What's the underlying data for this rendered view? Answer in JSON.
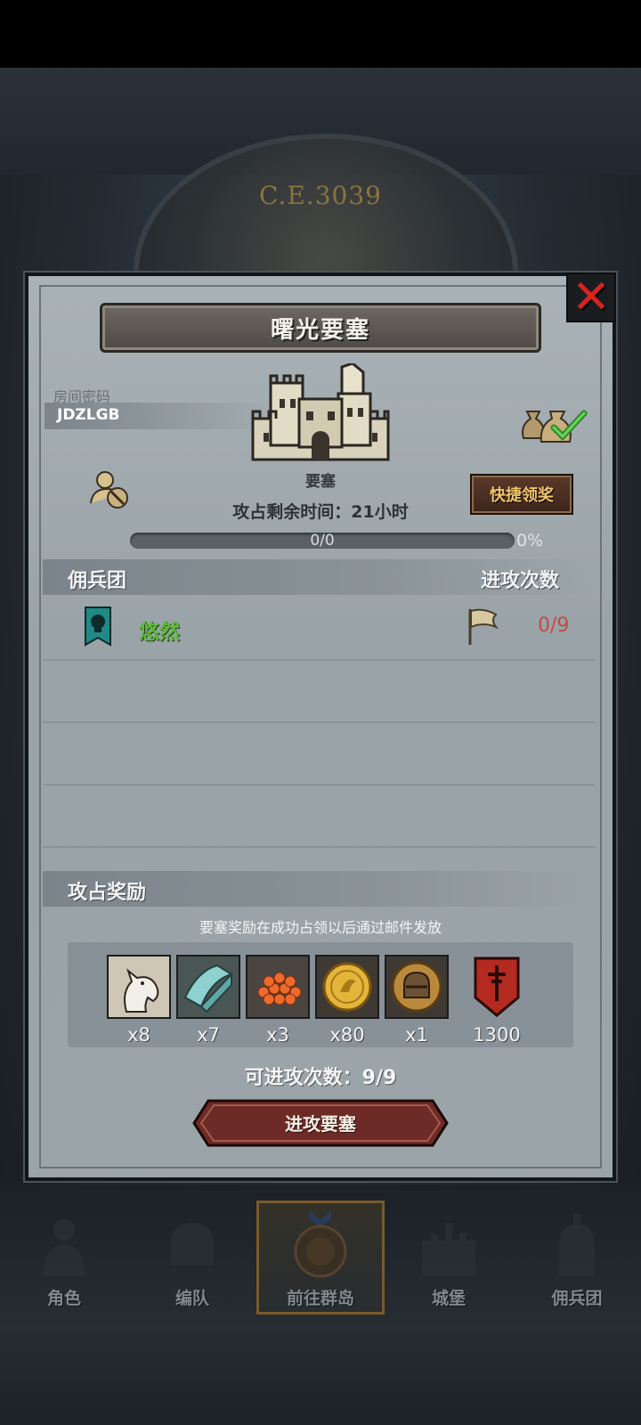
{
  "background": {
    "year_label": "C.E.3039"
  },
  "panel": {
    "title": "曙光要塞",
    "room_code_label": "房间密码",
    "room_code": "JDZLGB",
    "fortress_label": "要塞",
    "remaining_time": "攻占剩余时间：21小时",
    "quick_claim_label": "快捷领奖",
    "progress": {
      "text": "0/0",
      "percent_text": "0%",
      "fraction": 0
    }
  },
  "mercenary_section": {
    "header": "佣兵团",
    "attack_count_header": "进攻次数",
    "rows": [
      {
        "name": "悠然",
        "attacks": "0/9"
      }
    ]
  },
  "rewards": {
    "header": "攻占奖励",
    "note": "要塞奖励在成功占领以后通过邮件发放",
    "items": [
      {
        "icon": "horse-icon",
        "qty": "x8"
      },
      {
        "icon": "cloth-icon",
        "qty": "x7"
      },
      {
        "icon": "roe-icon",
        "qty": "x3"
      },
      {
        "icon": "gold-coin-icon",
        "qty": "x80"
      },
      {
        "icon": "knight-helmet-coin-icon",
        "qty": "x1"
      },
      {
        "icon": "red-banner-icon",
        "qty": "1300"
      }
    ]
  },
  "attempts_text": "可进攻次数：9/9",
  "attack_button_label": "进攻要塞",
  "nav": {
    "tabs": [
      {
        "label": "角色",
        "icon": "knight-icon"
      },
      {
        "label": "编队",
        "icon": "helmet-icon"
      },
      {
        "label": "前往群岛",
        "icon": "compass-icon",
        "active": true
      },
      {
        "label": "城堡",
        "icon": "castle-icon"
      },
      {
        "label": "佣兵团",
        "icon": "mercenary-icon"
      }
    ]
  },
  "colors": {
    "close_x": "#d8231f",
    "guild_name": "#5dbb3a",
    "attack_count": "#c24b44",
    "quick_claim_text": "#f2c56a",
    "attack_button": "#6e2a26"
  }
}
